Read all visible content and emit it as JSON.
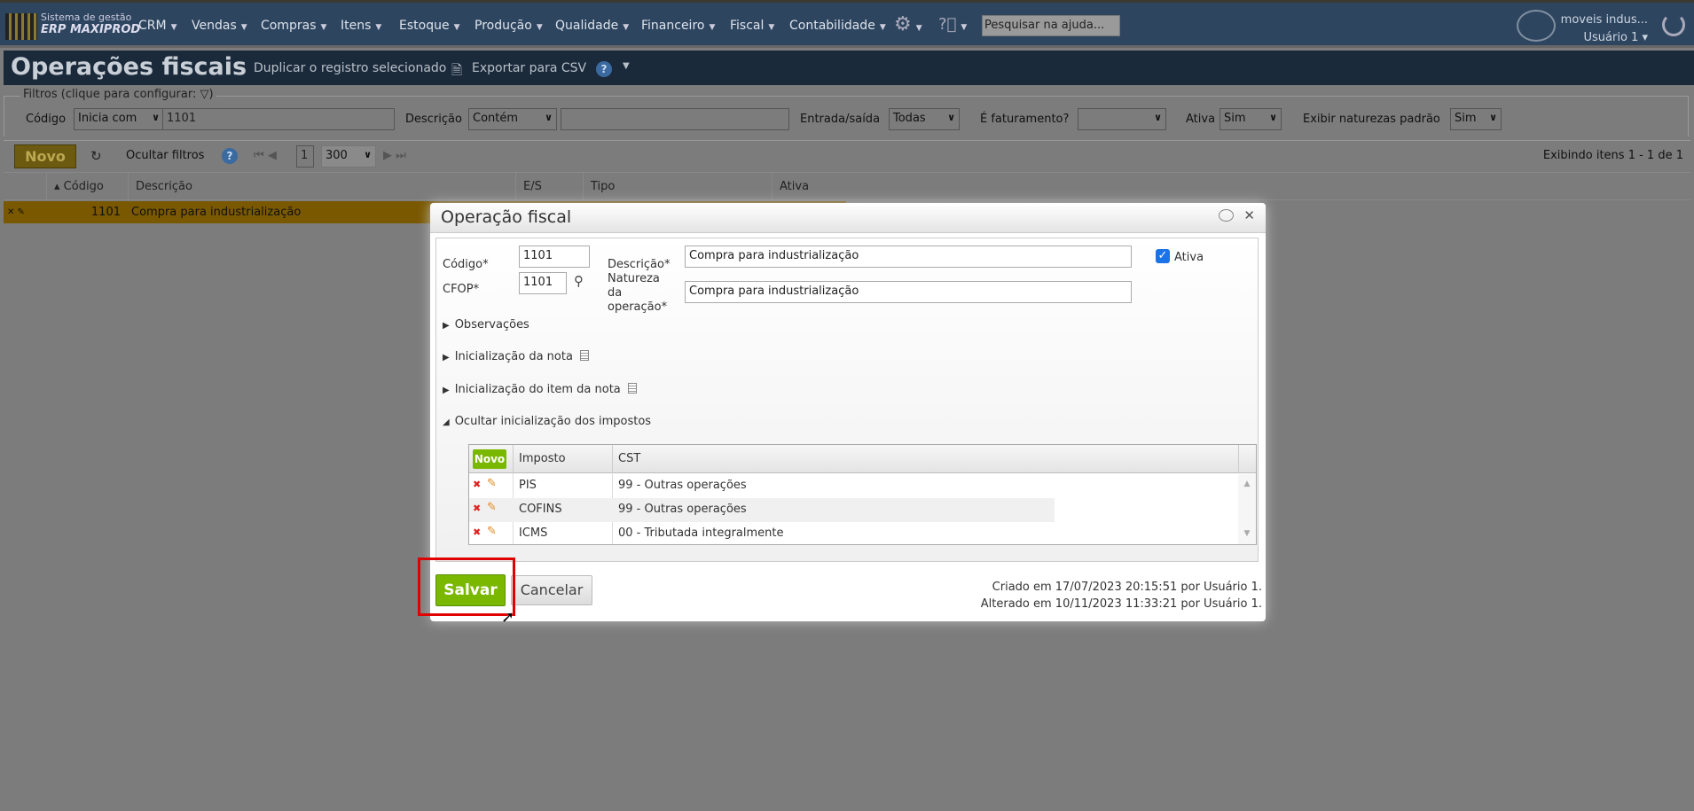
{
  "app": {
    "logo_line1": "Sistema de gestão",
    "logo_line2": "ERP MAXIPROD",
    "help_search_placeholder": "Pesquisar na ajuda...",
    "company": "moveis indus...",
    "user": "Usuário 1"
  },
  "menu": [
    "CRM",
    "Vendas",
    "Compras",
    "Itens",
    "Estoque",
    "Produção",
    "Qualidade",
    "Financeiro",
    "Fiscal",
    "Contabilidade"
  ],
  "page": {
    "title": "Operações fiscais",
    "duplicate": "Duplicar o registro selecionado",
    "export": "Exportar para CSV"
  },
  "filters": {
    "legend": "Filtros (clique para configurar:",
    "close_paren": ")",
    "codigo_label": "Código",
    "codigo_op": "Inicia com",
    "codigo_value": "1101",
    "descricao_label": "Descrição",
    "descricao_op": "Contém",
    "descricao_value": "",
    "es_label": "Entrada/saída",
    "es_value": "Todas",
    "fat_label": "É faturamento?",
    "fat_value": "",
    "ativa_label": "Ativa",
    "ativa_value": "Sim",
    "padrao_label": "Exibir naturezas padrão",
    "padrao_value": "Sim"
  },
  "toolbar": {
    "new": "Novo",
    "hide_filters": "Ocultar filtros",
    "page": "1",
    "page_size": "300",
    "showing": "Exibindo itens 1 - 1 de 1"
  },
  "grid": {
    "columns": [
      "Código",
      "Descrição",
      "E/S",
      "Tipo",
      "Ativa"
    ],
    "rows": [
      {
        "codigo": "1101",
        "descricao": "Compra para industrialização"
      }
    ]
  },
  "dialog": {
    "title": "Operação fiscal",
    "codigo_label": "Código*",
    "codigo": "1101",
    "descricao_label": "Descrição*",
    "descricao": "Compra para industrialização",
    "ativa_label": "Ativa",
    "ativa_checked": true,
    "cfop_label": "CFOP*",
    "cfop": "1101",
    "natureza_label": "Natureza da operação*",
    "natureza": "Compra para industrialização",
    "sections": [
      "Observações",
      "Inicialização da nota",
      "Inicialização do item da nota",
      "Ocultar inicialização dos impostos"
    ],
    "tax_table": {
      "new": "Novo",
      "columns": [
        "Imposto",
        "CST"
      ],
      "rows": [
        {
          "imposto": "PIS",
          "cst": "99 - Outras operações"
        },
        {
          "imposto": "COFINS",
          "cst": "99 - Outras operações"
        },
        {
          "imposto": "ICMS",
          "cst": "00 - Tributada integralmente"
        }
      ]
    },
    "save": "Salvar",
    "cancel": "Cancelar",
    "created": "Criado em 17/07/2023 20:15:51 por Usuário 1.",
    "modified": "Alterado em 10/11/2023 11:33:21 por Usuário 1."
  }
}
